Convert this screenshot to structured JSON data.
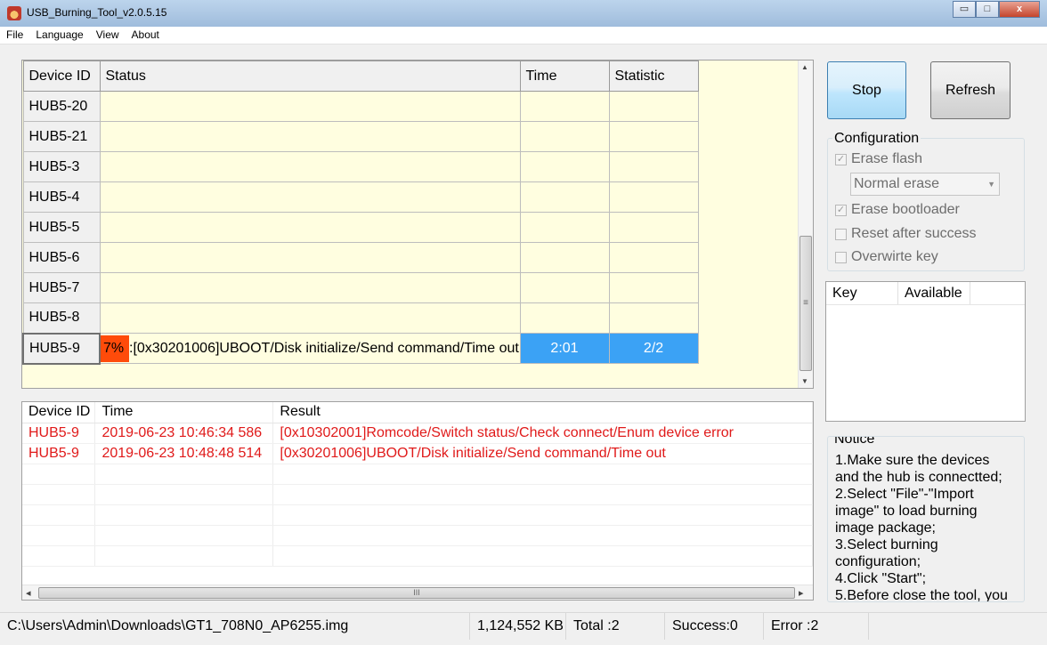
{
  "window": {
    "title": "USB_Burning_Tool_v2.0.5.15",
    "controls": {
      "minimize": "▭",
      "maximize": "□",
      "close": "x"
    }
  },
  "menu": [
    "File",
    "Language",
    "View",
    "About"
  ],
  "device_grid": {
    "headers": {
      "device_id": "Device ID",
      "status": "Status",
      "time": "Time",
      "statistic": "Statistic"
    },
    "rows": [
      {
        "device_id": "HUB5-20",
        "status": "",
        "time": "",
        "statistic": ""
      },
      {
        "device_id": "HUB5-21",
        "status": "",
        "time": "",
        "statistic": ""
      },
      {
        "device_id": "HUB5-3",
        "status": "",
        "time": "",
        "statistic": ""
      },
      {
        "device_id": "HUB5-4",
        "status": "",
        "time": "",
        "statistic": ""
      },
      {
        "device_id": "HUB5-5",
        "status": "",
        "time": "",
        "statistic": ""
      },
      {
        "device_id": "HUB5-6",
        "status": "",
        "time": "",
        "statistic": ""
      },
      {
        "device_id": "HUB5-7",
        "status": "",
        "time": "",
        "statistic": ""
      },
      {
        "device_id": "HUB5-8",
        "status": "",
        "time": "",
        "statistic": ""
      }
    ],
    "active_row": {
      "device_id": "HUB5-9",
      "progress": "7%",
      "status": ":[0x30201006]UBOOT/Disk initialize/Send command/Time out",
      "time": "2:01",
      "statistic": "2/2"
    },
    "scroll_arrows": {
      "up": "▲",
      "down": "▼"
    },
    "grip": "≡"
  },
  "buttons": {
    "stop": "Stop",
    "refresh": "Refresh"
  },
  "configuration": {
    "title": "Configuration",
    "erase_flash": {
      "label": "Erase flash",
      "checked": true
    },
    "erase_mode": "Normal erase",
    "erase_bootloader": {
      "label": "Erase bootloader",
      "checked": true
    },
    "reset_after_success": {
      "label": "Reset after success",
      "checked": false
    },
    "overwrite_key": {
      "label": "Overwirte key",
      "checked": false
    },
    "check_glyph": "✓",
    "dropdown_arrow": "▼"
  },
  "key_table": {
    "headers": [
      "Key",
      "Available"
    ]
  },
  "notice": {
    "title": "Notice",
    "lines": [
      "1.Make sure the devices and the hub is connectted;",
      "2.Select \"File\"-\"Import image\" to load burning image package;",
      "3.Select burning configuration;",
      "4.Click \"Start\";",
      "5.Before close the tool, you"
    ]
  },
  "log": {
    "headers": {
      "device_id": "Device ID",
      "time": "Time",
      "result": "Result"
    },
    "entries": [
      {
        "device_id": "HUB5-9",
        "time": "2019-06-23 10:46:34 586",
        "result": "[0x10302001]Romcode/Switch status/Check connect/Enum device error"
      },
      {
        "device_id": "HUB5-9",
        "time": "2019-06-23 10:48:48 514",
        "result": "[0x30201006]UBOOT/Disk initialize/Send command/Time out"
      }
    ],
    "scroll_arrows": {
      "left": "◂",
      "right": "▸"
    },
    "grip": "III"
  },
  "status_bar": {
    "image_path": "C:\\Users\\Admin\\Downloads\\GT1_708N0_AP6255.img",
    "size": "1,124,552 KB",
    "total": "Total :2",
    "success": "Success:0",
    "error": "Error :2"
  },
  "colors": {
    "grid_bg": "#fffee0",
    "progress": "#ff4b0a",
    "highlight": "#3ba2f5",
    "error_text": "#e01a1a"
  }
}
